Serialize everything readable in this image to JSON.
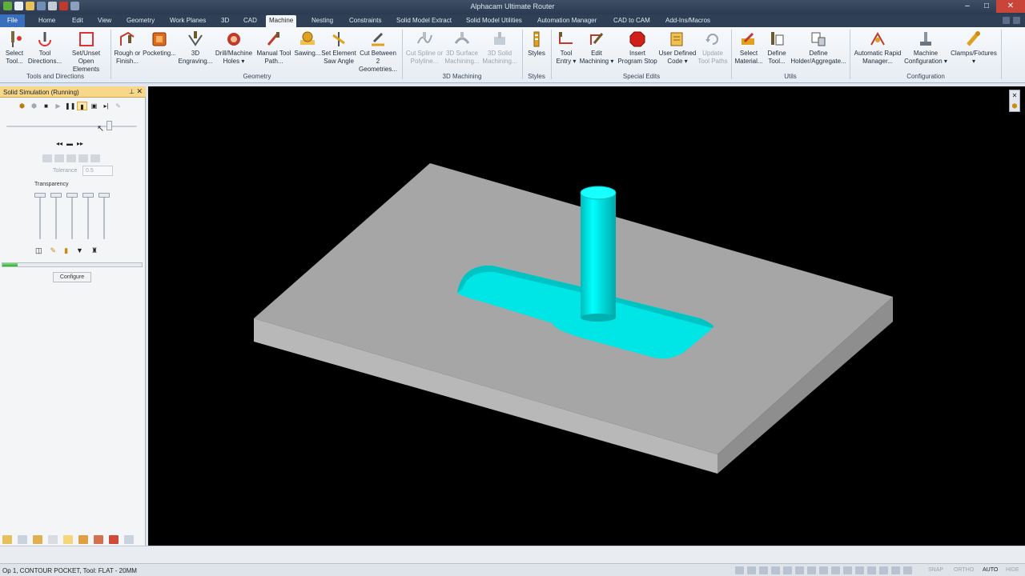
{
  "window": {
    "title": "Alphacam Ultimate Router"
  },
  "tabs": [
    {
      "label": "File"
    },
    {
      "label": "Home"
    },
    {
      "label": "Edit"
    },
    {
      "label": "View"
    },
    {
      "label": "Geometry"
    },
    {
      "label": "Work Planes"
    },
    {
      "label": "3D"
    },
    {
      "label": "CAD"
    },
    {
      "label": "Machine"
    },
    {
      "label": "Nesting"
    },
    {
      "label": "Constraints"
    },
    {
      "label": "Solid Model Extract"
    },
    {
      "label": "Solid Model Utilities"
    },
    {
      "label": "Automation Manager"
    },
    {
      "label": "CAD to CAM"
    },
    {
      "label": "Add-Ins/Macros"
    }
  ],
  "active_tab": "Machine",
  "ribbon": {
    "buttons": [
      {
        "l1": "Select",
        "l2": "Tool..."
      },
      {
        "l1": "Tool",
        "l2": "Directions..."
      },
      {
        "l1": "Set/Unset",
        "l2": "Open Elements"
      },
      {
        "l1": "Rough or",
        "l2": "Finish..."
      },
      {
        "l1": "Pocketing...",
        "l2": ""
      },
      {
        "l1": "3D",
        "l2": "Engraving..."
      },
      {
        "l1": "Drill/Machine",
        "l2": "Holes ▾"
      },
      {
        "l1": "Manual Tool",
        "l2": "Path..."
      },
      {
        "l1": "Sawing...",
        "l2": ""
      },
      {
        "l1": "Set Element",
        "l2": "Saw Angle"
      },
      {
        "l1": "Cut Between 2",
        "l2": "Geometries..."
      },
      {
        "l1": "Cut Spline or",
        "l2": "Polyline..."
      },
      {
        "l1": "3D Surface",
        "l2": "Machining..."
      },
      {
        "l1": "3D Solid",
        "l2": "Machining..."
      },
      {
        "l1": "Styles",
        "l2": ""
      },
      {
        "l1": "Tool",
        "l2": "Entry ▾"
      },
      {
        "l1": "Edit",
        "l2": "Machining ▾"
      },
      {
        "l1": "Insert",
        "l2": "Program Stop"
      },
      {
        "l1": "User Defined",
        "l2": "Code ▾"
      },
      {
        "l1": "Update",
        "l2": "Tool Paths"
      },
      {
        "l1": "Select",
        "l2": "Material..."
      },
      {
        "l1": "Define",
        "l2": "Tool..."
      },
      {
        "l1": "Define",
        "l2": "Holder/Aggregate..."
      },
      {
        "l1": "Automatic Rapid",
        "l2": "Manager..."
      },
      {
        "l1": "Machine",
        "l2": "Configuration ▾"
      },
      {
        "l1": "Clamps/Fixtures",
        "l2": "▾"
      }
    ],
    "groups": [
      {
        "label": "Tools and Directions"
      },
      {
        "label": "Geometry"
      },
      {
        "label": "3D Machining"
      },
      {
        "label": "Styles"
      },
      {
        "label": "Special Edits"
      },
      {
        "label": "Utils"
      },
      {
        "label": "Configuration"
      }
    ]
  },
  "panel": {
    "title": "Solid Simulation (Running)",
    "tolerance_label": "Tolerance",
    "tolerance_value": "0.5",
    "transparency_label": "Transparency",
    "configure_label": "Configure",
    "progress": 0.11,
    "speed_slider": 0.78
  },
  "status": {
    "message": "Op 1, CONTOUR POCKET, Tool: FLAT - 20MM",
    "flags": {
      "snap": "SNAP",
      "ortho": "ORTHO",
      "auto": "AUTO",
      "hide": "HIDE"
    }
  },
  "colors": {
    "part": "#a6a6a6",
    "pocket": "#00e5e5",
    "viewport_bg": "#000000",
    "panel_header": "#f7d88a"
  }
}
